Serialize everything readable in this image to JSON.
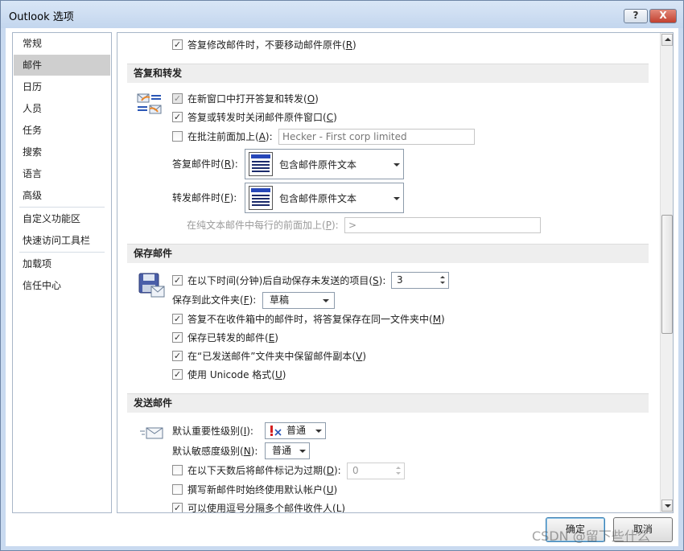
{
  "window": {
    "title": "Outlook 选项",
    "help_label": "?",
    "close_label": "X"
  },
  "sidebar": {
    "items": [
      {
        "label": "常规",
        "selected": false
      },
      {
        "label": "邮件",
        "selected": true
      },
      {
        "label": "日历",
        "selected": false
      },
      {
        "label": "人员",
        "selected": false
      },
      {
        "label": "任务",
        "selected": false
      },
      {
        "label": "搜索",
        "selected": false
      },
      {
        "label": "语言",
        "selected": false
      },
      {
        "label": "高级",
        "selected": false
      },
      {
        "label": "自定义功能区",
        "selected": false
      },
      {
        "label": "快速访问工具栏",
        "selected": false
      },
      {
        "label": "加载项",
        "selected": false
      },
      {
        "label": "信任中心",
        "selected": false
      }
    ]
  },
  "top_option": {
    "text": "答复修改邮件时，不要移动邮件原件(",
    "key": "R",
    "suffix": ")",
    "checked": true
  },
  "reply_forward": {
    "header": "答复和转发",
    "open_new_window": {
      "text": "在新窗口中打开答复和转发(",
      "key": "O",
      "suffix": ")",
      "checked": true,
      "disabled": false
    },
    "close_original": {
      "text": "答复或转发时关闭邮件原件窗口(",
      "key": "C",
      "suffix": ")",
      "checked": true
    },
    "preface_comments": {
      "text": "在批注前面加上(",
      "key": "A",
      "suffix": "):",
      "checked": false,
      "value": "Hecker - First corp limited"
    },
    "when_replying": {
      "label": "答复邮件时(",
      "key": "R",
      "suffix": "):",
      "value": "包含邮件原件文本"
    },
    "when_forwarding": {
      "label": "转发邮件时(",
      "key": "F",
      "suffix": "):",
      "value": "包含邮件原件文本"
    },
    "plain_text_prefix": {
      "label": "在纯文本邮件中每行的前面加上(",
      "key": "P",
      "suffix": "):",
      "value": ">"
    }
  },
  "save_messages": {
    "header": "保存邮件",
    "autosave": {
      "text": "在以下时间(分钟)后自动保存未发送的项目(",
      "key": "S",
      "suffix": "):",
      "checked": true,
      "value": "3"
    },
    "save_to_folder": {
      "label": "保存到此文件夹(",
      "key": "F",
      "suffix": "):",
      "value": "草稿"
    },
    "save_replies": {
      "text": "答复不在收件箱中的邮件时，将答复保存在同一文件夹中(",
      "key": "M",
      "suffix": ")",
      "checked": true
    },
    "save_forwarded": {
      "text": "保存已转发的邮件(",
      "key": "E",
      "suffix": ")",
      "checked": true
    },
    "keep_copies": {
      "text": "在“已发送邮件”文件夹中保留邮件副本(",
      "key": "V",
      "suffix": ")",
      "checked": true
    },
    "use_unicode": {
      "text": "使用 Unicode 格式(",
      "key": "U",
      "suffix": ")",
      "checked": true
    }
  },
  "send_messages": {
    "header": "发送邮件",
    "default_importance": {
      "label": "默认重要性级别(",
      "key": "I",
      "suffix": "):",
      "value": "普通"
    },
    "default_sensitivity": {
      "label": "默认敏感度级别(",
      "key": "N",
      "suffix": "):",
      "value": "普通"
    },
    "expire_after": {
      "text": "在以下天数后将邮件标记为过期(",
      "key": "D",
      "suffix": "):",
      "checked": false,
      "value": "0"
    },
    "always_default_account": {
      "text": "撰写新邮件时始终使用默认帐户(",
      "key": "U",
      "suffix": ")",
      "checked": false
    },
    "comma_separate": {
      "text": "可以使用逗号分隔多个邮件收件人(",
      "key": "L",
      "suffix": ")",
      "checked": true
    }
  },
  "footer": {
    "ok_label": "确定",
    "cancel_label": "取消"
  },
  "watermark": "CSDN @留下些什么",
  "check_glyph": "✓"
}
